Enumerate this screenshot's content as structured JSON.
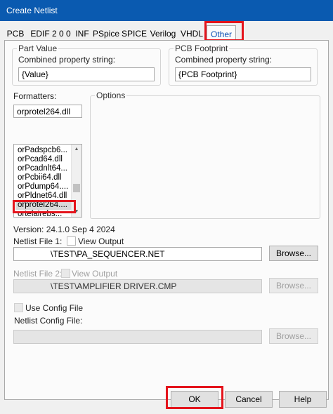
{
  "window": {
    "title": "Create Netlist"
  },
  "tabs": [
    "PCB",
    "EDIF 2 0 0",
    "INF",
    "PSpice",
    "SPICE",
    "Verilog",
    "VHDL",
    "Other"
  ],
  "active_tab": "Other",
  "part_value": {
    "legend": "Part Value",
    "label": "Combined property string:",
    "value": "{Value}"
  },
  "pcb_footprint": {
    "legend": "PCB Footprint",
    "label": "Combined property string:",
    "value": "{PCB Footprint}"
  },
  "formatters": {
    "label": "Formatters:",
    "current": "orprotel264.dll",
    "items": [
      "orPadspcb6...",
      "orPcad64.dll",
      "orPcadnlt64...",
      "orPcbii64.dll",
      "orPdump64....",
      "orPldnet64.dll",
      "orprotel264....",
      "ortelairebs..."
    ],
    "selected_index": 6
  },
  "options": {
    "legend": "Options"
  },
  "version_text": "Version: 24.1.0  Sep  4 2024",
  "netlist1": {
    "label": "Netlist File 1:",
    "view_output_label": "View Output",
    "path": "\\TEST\\PA_SEQUENCER.NET",
    "browse_label": "Browse..."
  },
  "netlist2": {
    "label": "Netlist File 2:",
    "view_output_label": "View Output",
    "path": "\\TEST\\AMPLIFIER DRIVER.CMP",
    "browse_label": "Browse..."
  },
  "config": {
    "use_label": "Use Config File",
    "file_label": "Netlist Config File:",
    "path": "",
    "browse_label": "Browse..."
  },
  "footer": {
    "ok": "OK",
    "cancel": "Cancel",
    "help": "Help"
  },
  "colors": {
    "title_bar": "#0a5ab0",
    "highlight": "#e4141c",
    "active_tab_text": "#0a4fb3"
  }
}
